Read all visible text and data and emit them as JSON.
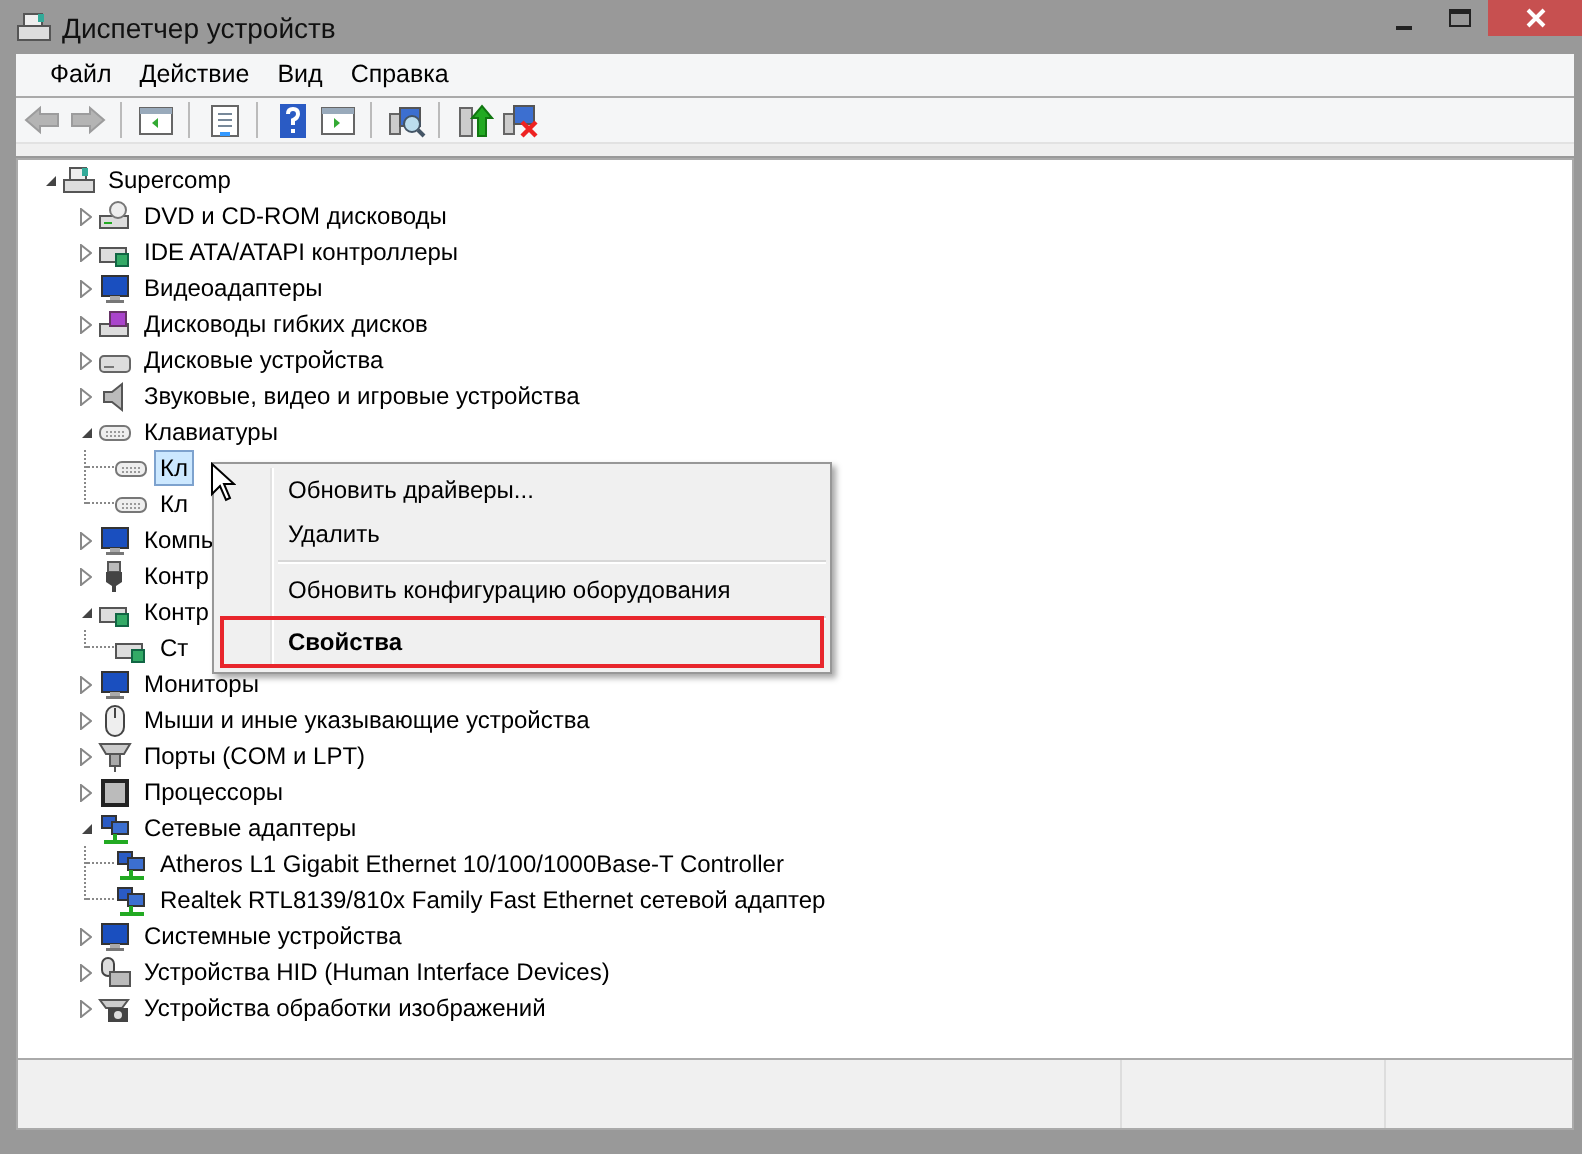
{
  "window": {
    "title": "Диспетчер устройств"
  },
  "menu_bar": [
    "Файл",
    "Действие",
    "Вид",
    "Справка"
  ],
  "toolbar": [
    {
      "kind": "back",
      "disabled": true
    },
    {
      "kind": "forward",
      "disabled": true
    },
    {
      "kind": "separator"
    },
    {
      "kind": "pane",
      "disabled": false
    },
    {
      "kind": "separator"
    },
    {
      "kind": "properties",
      "disabled": false
    },
    {
      "kind": "separator"
    },
    {
      "kind": "help",
      "disabled": false
    },
    {
      "kind": "pane2",
      "disabled": false
    },
    {
      "kind": "separator"
    },
    {
      "kind": "scan",
      "disabled": false
    },
    {
      "kind": "separator"
    },
    {
      "kind": "update",
      "disabled": false
    },
    {
      "kind": "uninstall",
      "disabled": false
    }
  ],
  "tree": {
    "label": "Supercomp",
    "kind": "computer",
    "expanded": true,
    "selected": false,
    "children": [
      {
        "label": "DVD и CD-ROM дисководы",
        "kind": "dvd",
        "expanded": false,
        "selected": false
      },
      {
        "label": "IDE ATA/ATAPI контроллеры",
        "kind": "ide",
        "expanded": false,
        "selected": false
      },
      {
        "label": "Видеоадаптеры",
        "kind": "display",
        "expanded": false,
        "selected": false
      },
      {
        "label": "Дисководы гибких дисков",
        "kind": "floppy",
        "expanded": false,
        "selected": false
      },
      {
        "label": "Дисковые устройства",
        "kind": "disk",
        "expanded": false,
        "selected": false
      },
      {
        "label": "Звуковые, видео и игровые устройства",
        "kind": "sound",
        "expanded": false,
        "selected": false
      },
      {
        "label": "Клавиатуры",
        "kind": "keyboard",
        "expanded": true,
        "selected": false,
        "children": [
          {
            "label": "Кл",
            "kind": "keyboard",
            "selected": true
          },
          {
            "label": "Кл",
            "kind": "keyboard",
            "selected": false
          }
        ]
      },
      {
        "label": "Компь",
        "kind": "display",
        "expanded": false,
        "selected": false
      },
      {
        "label": "Контр",
        "kind": "usb",
        "expanded": false,
        "selected": false
      },
      {
        "label": "Контр",
        "kind": "ide",
        "expanded": true,
        "selected": false,
        "children": [
          {
            "label": "Ст",
            "kind": "ide",
            "selected": false
          }
        ]
      },
      {
        "label": "Мониторы",
        "kind": "display",
        "expanded": false,
        "selected": false
      },
      {
        "label": "Мыши и иные указывающие устройства",
        "kind": "mouse",
        "expanded": false,
        "selected": false
      },
      {
        "label": "Порты (COM и LPT)",
        "kind": "port",
        "expanded": false,
        "selected": false
      },
      {
        "label": "Процессоры",
        "kind": "cpu",
        "expanded": false,
        "selected": false
      },
      {
        "label": "Сетевые адаптеры",
        "kind": "network",
        "expanded": true,
        "selected": false,
        "children": [
          {
            "label": "Atheros L1 Gigabit Ethernet 10/100/1000Base-T Controller",
            "kind": "network",
            "selected": false
          },
          {
            "label": "Realtek RTL8139/810x Family Fast Ethernet сетевой адаптер",
            "kind": "network",
            "selected": false
          }
        ]
      },
      {
        "label": "Системные устройства",
        "kind": "display",
        "expanded": false,
        "selected": false
      },
      {
        "label": "Устройства HID (Human Interface Devices)",
        "kind": "hid",
        "expanded": false,
        "selected": false
      },
      {
        "label": "Устройства обработки изображений",
        "kind": "camera",
        "expanded": false,
        "selected": false
      }
    ]
  },
  "context_menu": {
    "items": [
      {
        "kind": "item",
        "label": "Обновить драйверы...",
        "default": false,
        "outlined": false
      },
      {
        "kind": "item",
        "label": "Удалить",
        "default": false,
        "outlined": false
      },
      {
        "kind": "separator"
      },
      {
        "kind": "item",
        "label": "Обновить конфигурацию оборудования",
        "default": false,
        "outlined": false
      },
      {
        "kind": "separator"
      },
      {
        "kind": "item",
        "label": "Свойства",
        "default": true,
        "outlined": true
      }
    ]
  }
}
